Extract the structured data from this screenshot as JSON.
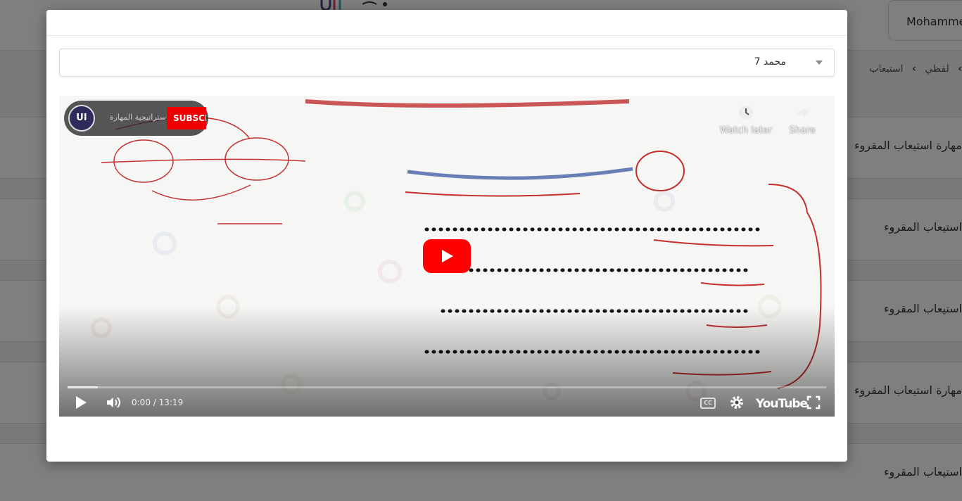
{
  "header": {
    "user_name": "Mohammed"
  },
  "breadcrumb": {
    "items": [
      "لفظي",
      "استيعاب"
    ]
  },
  "lessons": [
    {
      "label": "مهارة استيعاب المقروء"
    },
    {
      "label": "استيعاب المقروء"
    },
    {
      "label": "استيعاب المقروء"
    },
    {
      "label": "مهارة استيعاب المقروء"
    },
    {
      "label": "استيعاب المقروء"
    }
  ],
  "modal": {
    "video_select": {
      "selected": "محمد 7"
    },
    "video": {
      "channel_name": "استراتيجية المهارة",
      "avatar_text": "UI",
      "subscribe_label": "SUBSCRIBE",
      "watch_later_label": "Watch later",
      "share_label": "Share",
      "time_display": "0:00 / 13:19",
      "progress_loaded_fraction": 0.04,
      "youtube_label": "YouTube",
      "cc_label": "CC"
    }
  },
  "colors": {
    "youtube_red": "#ff0000",
    "overlay": "rgba(0,0,0,0.5)"
  }
}
